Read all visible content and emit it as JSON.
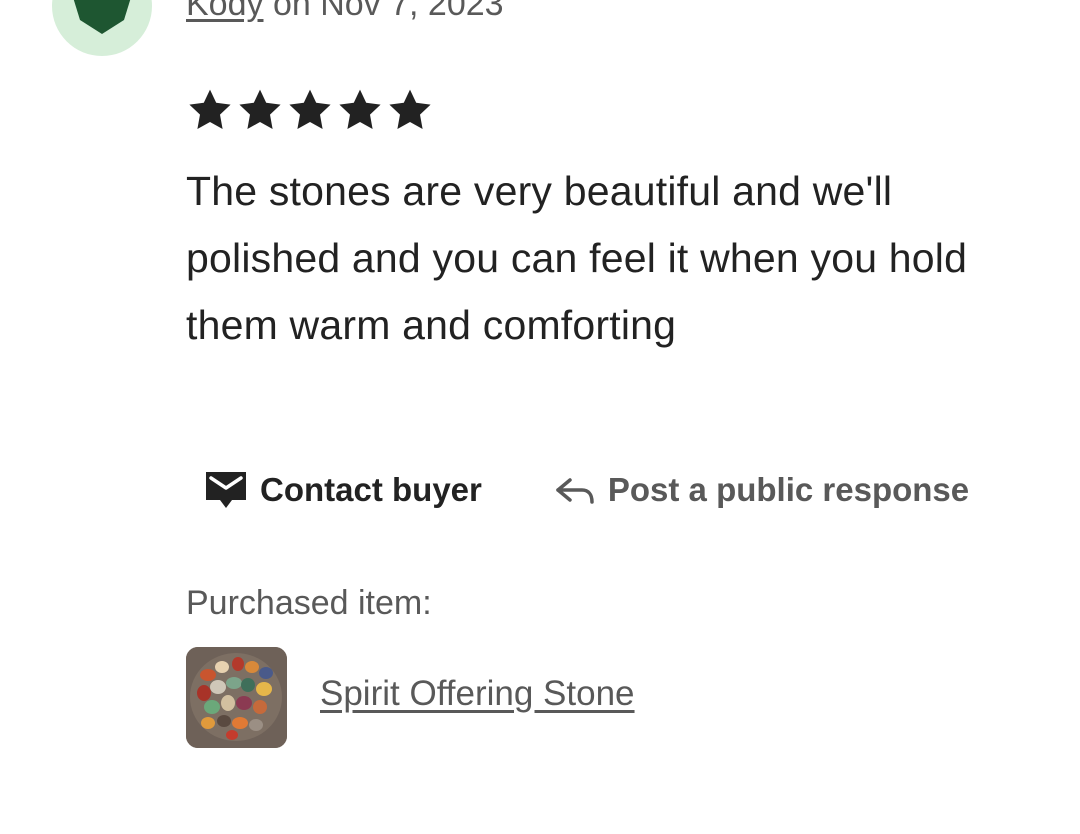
{
  "review": {
    "author": "Kody",
    "date_prefix": " on ",
    "date": "Nov 7, 2023",
    "rating_stars": 5,
    "text": "The stones are very beautiful and we'll polished and you can feel it when you hold them warm and comforting"
  },
  "actions": {
    "contact_label": "Contact buyer",
    "respond_label": "Post a public response"
  },
  "purchased": {
    "label": "Purchased item:",
    "item_name": "Spirit Offering Stone"
  },
  "colors": {
    "avatar_bg": "#d6eed9",
    "avatar_fg": "#1e5631",
    "text_primary": "#222222",
    "text_secondary": "#595959"
  }
}
